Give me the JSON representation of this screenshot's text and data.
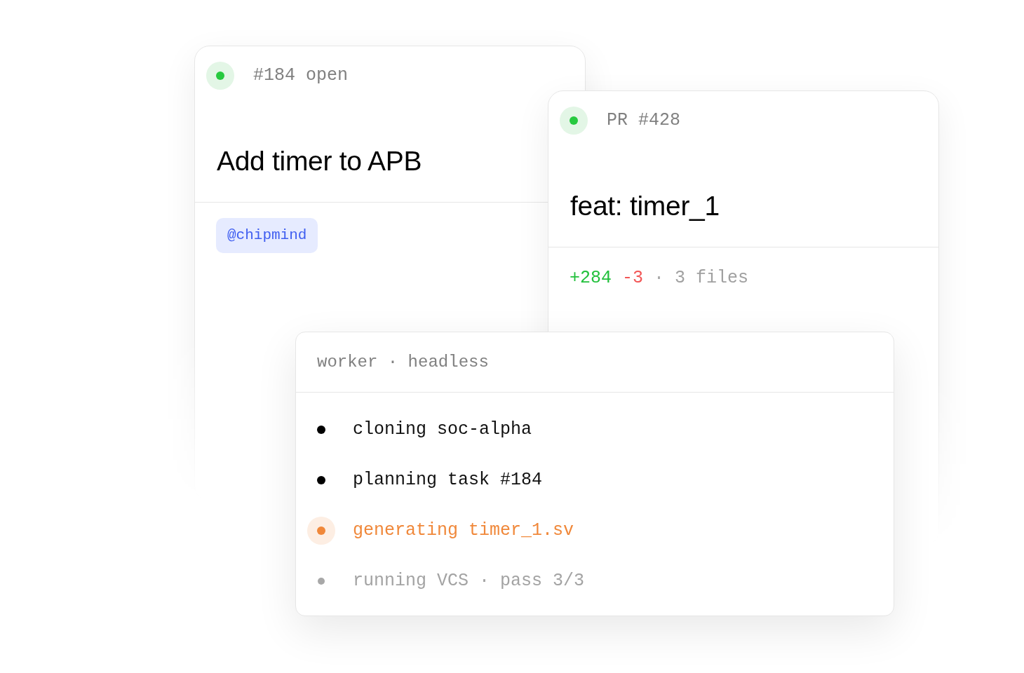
{
  "issue": {
    "label": "#184 open",
    "title": "Add timer to APB",
    "mention": "@chipmind"
  },
  "pull_request": {
    "label": "PR #428",
    "title": "feat: timer_1",
    "diff": {
      "added": "+284",
      "removed": "-3",
      "separator": "·",
      "files": "3 files"
    }
  },
  "worker": {
    "title": "worker · headless",
    "steps": [
      {
        "text": "cloning soc-alpha",
        "kind": "done"
      },
      {
        "text": "planning task #184",
        "kind": "done"
      },
      {
        "text": "generating timer_1.sv",
        "kind": "active"
      },
      {
        "text": "running VCS · pass 3/3",
        "kind": "pending"
      }
    ]
  }
}
